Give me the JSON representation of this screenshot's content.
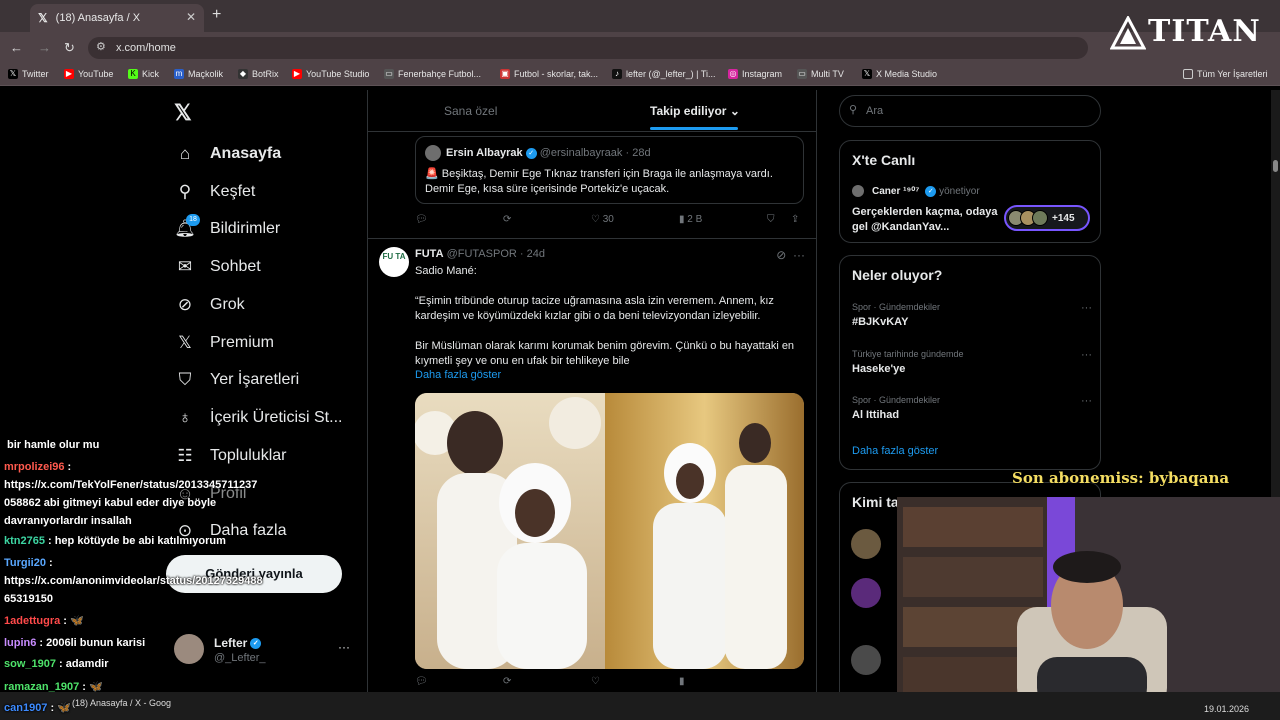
{
  "browser": {
    "tab_title": "(18) Anasayfa / X",
    "url": "x.com/home",
    "bookmarks": [
      "Twitter",
      "YouTube",
      "Kick",
      "Maçkolik",
      "BotRix",
      "YouTube Studio",
      "Fenerbahçe Futbol...",
      "Futbol - skorlar, tak...",
      "lefter (@_lefter_) | Ti...",
      "Instagram",
      "Multi TV",
      "X Media Studio"
    ],
    "all_bookmarks": "Tüm Yer İşaretleri"
  },
  "nav": {
    "items": [
      "Anasayfa",
      "Keşfet",
      "Bildirimler",
      "Sohbet",
      "Grok",
      "Premium",
      "Yer İşaretleri",
      "İçerik Üreticisi St...",
      "Topluluklar",
      "Profil",
      "Daha fazla"
    ],
    "notif_count": "18",
    "post_button": "Gönderi yayınla",
    "profile_name": "Lefter",
    "profile_handle": "@_Lefter_",
    "profile_more": "···"
  },
  "feed": {
    "tabs": [
      "Sana özel",
      "Takip ediliyor"
    ],
    "quote": {
      "name": "Ersin Albayrak",
      "handle": "@ersinalbayraak",
      "time": "· 28d",
      "text": "🚨 Beşiktaş, Demir Ege Tıknaz transferi için Braga ile anlaşmaya vardı. Demir Ege, kısa süre içerisinde Portekiz'e uçacak."
    },
    "quote_actions": {
      "likes": "30",
      "views": "2 B"
    },
    "post": {
      "name": "FUTA",
      "handle": "@FUTASPOR",
      "time": "· 24d",
      "avatar_text": "FU TA",
      "line1": "Sadio Mané:",
      "line2": "“Eşimin tribünde oturup tacize uğramasına asla izin veremem. Annem, kız kardeşim ve köyümüzdeki kızlar gibi o da beni televizyondan izleyebilir.",
      "line3": "Bir Müslüman olarak karımı korumak benim görevim. Çünkü o bu hayattaki en kıymetli şey ve onu en ufak bir tehlikeye bile",
      "show_more": "Daha fazla göster"
    }
  },
  "sidebar": {
    "search_placeholder": "Ara",
    "live": {
      "title": "X'te Canlı",
      "host": "Caner ¹⁹⁰⁷",
      "role": "yönetiyor",
      "space_title": "Gerçeklerden kaçma, odaya gel @KandanYav...",
      "listeners": "+145"
    },
    "trends": {
      "title": "Neler oluyor?",
      "items": [
        {
          "meta": "Spor · Gündemdekiler",
          "name": "#BJKvKAY"
        },
        {
          "meta": "Türkiye tarihinde gündemde",
          "name": "Haseke'ye"
        },
        {
          "meta": "Spor · Gündemdekiler",
          "name": "Al Ittihad"
        }
      ],
      "show_more": "Daha fazla göster"
    },
    "who_to_follow": "Kimi takip etmeli"
  },
  "overlay": {
    "brand": "TITAN",
    "subscriber": "Son abonemiss: bybaqana",
    "chat": [
      {
        "user": "",
        "msg": "bir hamle olur mu",
        "color": "#ffffff"
      },
      {
        "user": "mrpolizei96",
        "msg": ":",
        "color": "#ff5a4e"
      },
      {
        "user": "",
        "msg": "https://x.com/TekYolFener/status/2013345711237",
        "color": "#ffffff"
      },
      {
        "user": "",
        "msg": "058862 abi gitmeyi kabul eder diye böyle",
        "color": "#ffffff"
      },
      {
        "user": "",
        "msg": "davranıyorlardır insallah",
        "color": "#ffffff"
      },
      {
        "user": "ktn2765",
        "msg": ": hep kötüyde be abi katılmıyorum",
        "color": "#3dd6a3"
      },
      {
        "user": "Turgii20",
        "msg": ":",
        "color": "#5aa8ff"
      },
      {
        "user": "",
        "msg": "https://x.com/anonimvideolar/status/20127329488",
        "color": "#ffffff"
      },
      {
        "user": "",
        "msg": "65319150",
        "color": "#ffffff"
      },
      {
        "user": "1adettugra",
        "msg": ": 🦋",
        "color": "#ff4a4a"
      },
      {
        "user": "lupin6",
        "msg": ": 2006li bunun karisi",
        "color": "#c88cff"
      },
      {
        "user": "sow_1907",
        "msg": ": adamdir",
        "color": "#4ee36a"
      },
      {
        "user": "ramazan_1907",
        "msg": ": 🦋",
        "color": "#4ee36a"
      },
      {
        "user": "can1907",
        "msg": ": 🦋",
        "color": "#3d8bff"
      }
    ],
    "taskbar_title": "(18) Anasayfa / X - Goog",
    "date": "19.01.2026"
  },
  "colors": {
    "accent": "#1d9bf0",
    "bg": "#000000",
    "border": "#2f3336",
    "muted": "#71767b"
  }
}
